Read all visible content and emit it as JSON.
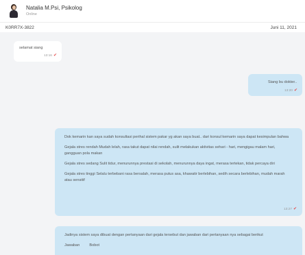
{
  "header": {
    "name": "Natalia M.Psi, Psikolog",
    "status": "Online"
  },
  "info": {
    "code": "K0RR7X-3822",
    "date": "Juni 11, 2021"
  },
  "messages": [
    {
      "text": "selamat siang",
      "time": "13:16"
    },
    {
      "text": "Siang bu dokter..",
      "time": "13:20"
    },
    {
      "paragraphs": [
        "Dok kemarin kan saya sudah konsultasi perihal sistem pakar yg akan saya buat.. dari konsul kemarin saya dapat kesimpulan bahwa",
        "Gejala stres rendah Mudah lelah, rasa takut dapat nilai rendah, sulit melakukan aktivitas sehari - hari, mengigau malam hari, gangguan pola makan",
        "Gejala stres sedang Sulit tidur, menurunnya prestasi di sekolah, menurunnya daya ingat, merasa tertekan, tidak percaya diri",
        "Gejala stres tinggi Selalu terbebani rasa bersalah, merasa putus asa, khawatir berlebihan, sedih secara berlebihan, mudah marah atau sensitif"
      ],
      "time": "13:27"
    },
    {
      "paragraphs": [
        "Jadinya sistem saya dibuat dengan pertanyaan dari gejala tersebut dan jawaban dari pertanyaan nya sebagai berikut",
        "Jawaban         Bobot"
      ]
    }
  ],
  "colors": {
    "incoming": "#ffffff",
    "outgoing": "#cde6f5",
    "read_check": "#e44c4c"
  }
}
